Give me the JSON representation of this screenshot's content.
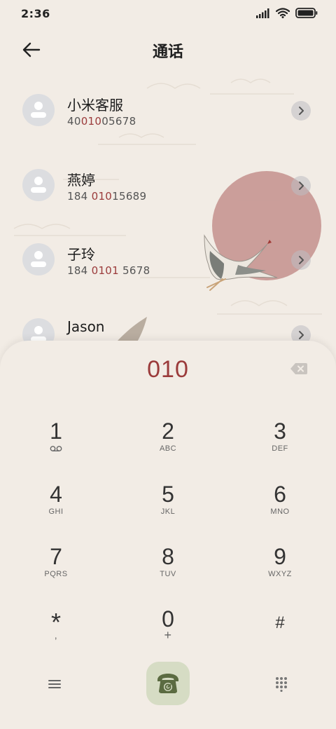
{
  "status_bar": {
    "time": "2:36"
  },
  "header": {
    "title": "通话"
  },
  "contacts": [
    {
      "name": "小米客服",
      "number_parts": [
        "40",
        "010",
        "05678"
      ]
    },
    {
      "name": "燕婷",
      "number_parts": [
        "184 ",
        "010",
        "15689"
      ]
    },
    {
      "name": "子玲",
      "number_parts": [
        "184 ",
        "0101",
        " 5678"
      ]
    },
    {
      "name": "Jason",
      "number_parts": [
        "",
        "",
        ""
      ]
    }
  ],
  "dialpad": {
    "input": "010",
    "keys": [
      {
        "digit": "1",
        "letters": ""
      },
      {
        "digit": "2",
        "letters": "ABC"
      },
      {
        "digit": "3",
        "letters": "DEF"
      },
      {
        "digit": "4",
        "letters": "GHI"
      },
      {
        "digit": "5",
        "letters": "JKL"
      },
      {
        "digit": "6",
        "letters": "MNO"
      },
      {
        "digit": "7",
        "letters": "PQRS"
      },
      {
        "digit": "8",
        "letters": "TUV"
      },
      {
        "digit": "9",
        "letters": "WXYZ"
      },
      {
        "digit": "*",
        "letters": ","
      },
      {
        "digit": "0",
        "letters": "+"
      },
      {
        "digit": "#",
        "letters": ""
      }
    ]
  },
  "colors": {
    "background": "#f2ece5",
    "highlight": "#9b3b3b",
    "sun": "#c89a96",
    "call_button": "#d6dcc4",
    "call_icon": "#5b6b41"
  },
  "icons": {
    "back": "arrow-left-icon",
    "backspace": "backspace-icon",
    "voicemail": "voicemail-icon",
    "menu": "menu-icon",
    "call": "phone-icon",
    "dialpad": "dialpad-icon"
  }
}
